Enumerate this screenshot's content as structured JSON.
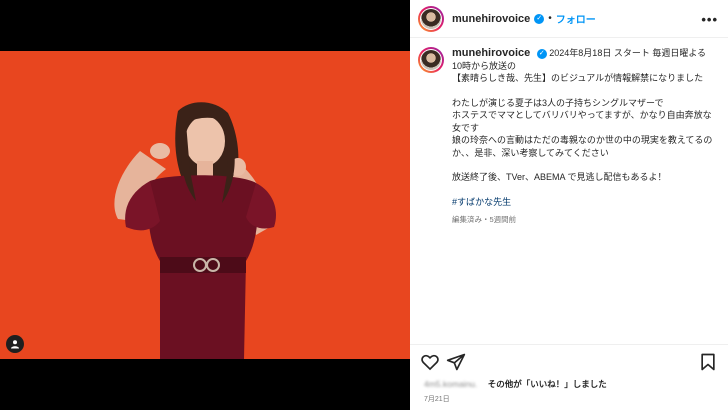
{
  "post": {
    "username": "munehirovoice",
    "follow_label": "フォロー",
    "more_label": "•••",
    "caption": {
      "line1": "2024年8月18日 スタート 毎週日曜よる10時から放送の",
      "line2": "【素晴らしき哉、先生】のビジュアルが情報解禁になりました",
      "line3": "わたしが演じる夏子は3人の子持ちシングルマザーで",
      "line4": "ホステスでママとしてバリバリやってますが、かなり自由奔放な女です",
      "line5": "娘の玲奈への言動はただの毒親なのか世の中の現実を教えてるのか、、是非、深い考察してみてください",
      "line6": "放送終了後、TVer、ABEMA で見逃し配信もあるよ！",
      "hashtag": "#すばかな先生"
    },
    "meta": "編集済み・5週間前",
    "likes_user": "4m5.komainu.",
    "likes_text": "その他が「いいね！」しました",
    "date": "7月21日"
  },
  "icons": {
    "verified": "verified-badge-icon",
    "like": "heart-icon",
    "share": "share-icon",
    "save": "bookmark-icon",
    "tag": "user-tag-icon"
  },
  "colors": {
    "photo_background": "#e8461f",
    "dress": "#6b1022",
    "link_blue": "#0095f6"
  }
}
